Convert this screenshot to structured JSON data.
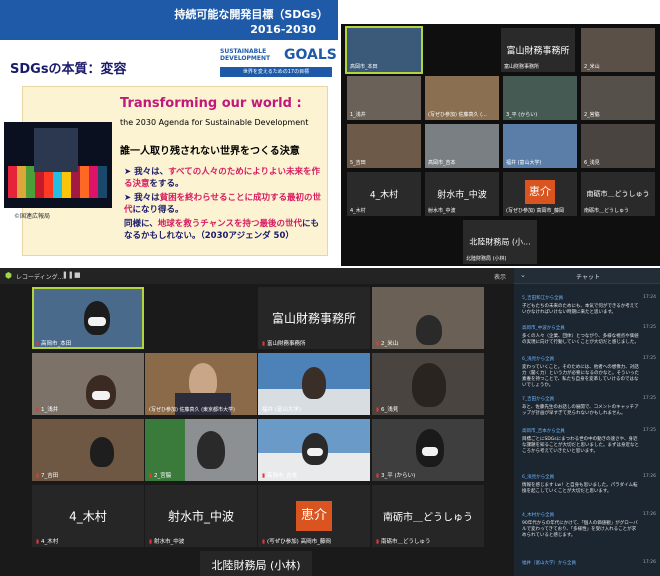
{
  "slide": {
    "banner_title": "持続可能な開発目標（SDGs）",
    "banner_years": "2016-2030",
    "heading": "SDGsの本質：変容",
    "logo_line1": "SUSTAINABLE",
    "logo_line2": "DEVELOPMENT",
    "logo_goals": "GOALS",
    "logo_tagline": "世界を変えるための17の目標",
    "title": "Transforming our world :",
    "subtitle": "the 2030 Agenda for Sustainable Development",
    "leave_behind": "誰一人取り残されない世界をつくる決意",
    "bullet1_a": "我々は、",
    "bullet1_b": "すべての人々のためによりよい未来を作る決意",
    "bullet1_c": "をする。",
    "bullet2_a": "我々は",
    "bullet2_b": "貧困を終わらせることに成功する最初の世代",
    "bullet2_c": "になり得る。",
    "bullet3_a": "同様に、",
    "bullet3_b": "地球を救うチャンスを持つ最後の世代",
    "bullet3_c": "にもなるかもしれない。（2030アジェンダ 50）",
    "photo_credit": "©国連広報局"
  },
  "zoom_small": {
    "tiles": [
      {
        "name": "高岡市_本田"
      },
      {
        "big": "富山財務事務所",
        "name": "富山財務事務所"
      },
      {
        "name": "2_米山"
      },
      {
        "name": "1_浅井"
      },
      {
        "name": "(写ぜひ参加) 佐藤真久 (..."
      },
      {
        "name": "3_平 (からい)"
      },
      {
        "name": "2_宮脇"
      },
      {
        "name": "5_吉田"
      },
      {
        "name": "高岡市_吉本"
      },
      {
        "name": "福井 (富山大学)"
      },
      {
        "name": "6_浅見"
      },
      {
        "big": "4_木村",
        "name": "4_木村"
      },
      {
        "big": "射水市_中波",
        "name": "射水市_中波"
      },
      {
        "big": "恵介",
        "name": "(写ぜひ参加) 高岡市_藤岡"
      },
      {
        "big": "南砺市＿どうしゅう",
        "name": "南砺市＿どうしゅう"
      },
      {
        "big": "北陸財務局 (小...",
        "name": "北陸財務局 (小林)"
      }
    ]
  },
  "zoom_main": {
    "recording": "レコーディング...",
    "view": "表示",
    "tiles": [
      {
        "name": "高岡市_本田"
      },
      {
        "big": "富山財務事務所",
        "name": "富山財務事務所"
      },
      {
        "name": "2_米山"
      },
      {
        "name": "1_浅井"
      },
      {
        "name": "(写ぜひ参加) 佐藤真久 (東京都市大学)"
      },
      {
        "name": "福井 (富山大学)"
      },
      {
        "name": "6_浅見"
      },
      {
        "name": "7_吉田"
      },
      {
        "name": "2_宮脇"
      },
      {
        "name": "高岡市_吉本"
      },
      {
        "name": "3_平 (からい)"
      },
      {
        "big": "4_木村",
        "name": "4_木村"
      },
      {
        "big": "射水市_中波",
        "name": "射水市_中波"
      },
      {
        "avatar": "恵介",
        "name": "(写ぜひ参加) 高岡市_藤岡"
      },
      {
        "big": "南砺市＿どうしゅう",
        "name": "南砺市＿どうしゅう"
      },
      {
        "big": "北陸財務局 (小林)"
      }
    ]
  },
  "chat": {
    "title": "チャット",
    "messages": [
      {
        "from": "5_吉田和江から全員",
        "time": "17:24",
        "text": "子どもたちの未来のためにも、本気で何ができるか考えていかなければいけない時期に来たと思います。"
      },
      {
        "from": "高岡市_中波から全員",
        "time": "17:25",
        "text": "多くの人々（企業、団体）とつながり、多様な視点や価値の実現に向けて行動していくことが大切だと感じました。"
      },
      {
        "from": "6_浅見から全員",
        "time": "17:25",
        "text": "変わっていくこと。そのためには、他者への想像力、対話力（聞く力）という力が必要になるのかなと。そういった素養を持つことで、私たち自身を変革していけるのではないでしょうか。"
      },
      {
        "from": "7_吉田から全員",
        "time": "17:25",
        "text": "あと、佐藤先生のお話しの展開で、コメントのキャッチアップが計画が早すぎて見られないかもしれません。"
      },
      {
        "from": "高岡市_吉本から全員",
        "time": "17:25",
        "text": "目標ごとにSDGsにまつわる世の中の動きの速さや、身近な課題を知ることが大切だと思いました。まずは身近なところから考えていきたいと思います。"
      },
      {
        "from": "6_浅見から全員",
        "time": "17:26",
        "text": "情報を感じます Lw！と自身も思いました。パラダイム転換を起こしていくことが大切だと思います。"
      },
      {
        "from": "4_木村から全員",
        "time": "17:26",
        "text": "90年代からの年代にかけて、「個人の価値観」がグローバルで変わってきており、「多様性」を受け入れることが求められていると感じます。"
      },
      {
        "from": "福井（富山大学）から全員",
        "time": "17:26",
        "text": ""
      }
    ]
  },
  "colors": {
    "banner_blue": "#1e5aa8",
    "slide_box": "#fcf3d2",
    "magenta": "#c2187a",
    "active_speaker": "#b5d33b",
    "avatar_orange": "#d9541e",
    "chat_bg": "#1c2630",
    "chat_name": "#6fb6ff"
  }
}
